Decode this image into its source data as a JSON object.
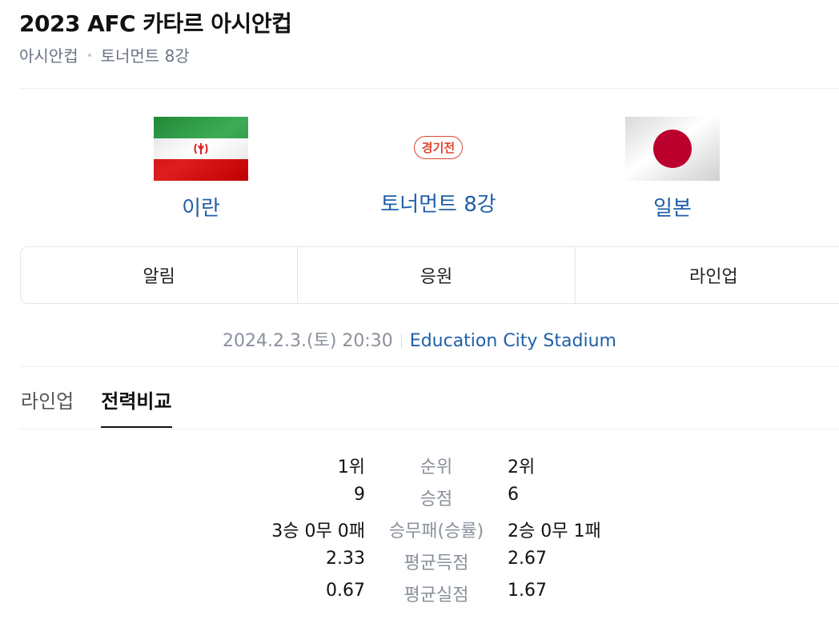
{
  "header": {
    "title": "2023 AFC 카타르 아시안컵",
    "competition": "아시안컵",
    "stage": "토너먼트 8강"
  },
  "match": {
    "home": {
      "name": "이란",
      "flag_icon": "iran-flag-icon"
    },
    "away": {
      "name": "일본",
      "flag_icon": "japan-flag-icon"
    },
    "status_badge": "경기전",
    "round": "토너먼트 8강",
    "datetime": "2024.2.3.(토) 20:30",
    "venue": "Education City Stadium"
  },
  "actions": {
    "notify": "알림",
    "cheer": "응원",
    "lineup": "라인업"
  },
  "tabs": [
    {
      "label": "라인업",
      "active": false
    },
    {
      "label": "전력비교",
      "active": true
    }
  ],
  "comparison": [
    {
      "label": "순위",
      "home": "1위",
      "away": "2위"
    },
    {
      "label": "승점",
      "home": "9",
      "away": "6"
    },
    {
      "label": "승무패(승률)",
      "home": "3승 0무 0패",
      "away": "2승 0무 1패"
    },
    {
      "label": "평균득점",
      "home": "2.33",
      "away": "2.67"
    },
    {
      "label": "평균실점",
      "home": "0.67",
      "away": "1.67"
    }
  ],
  "colors": {
    "link_blue": "#1f5fa8",
    "badge_red": "#e0452d",
    "iran_green": "#239f40",
    "iran_red": "#da0000",
    "japan_red": "#bc002d"
  }
}
